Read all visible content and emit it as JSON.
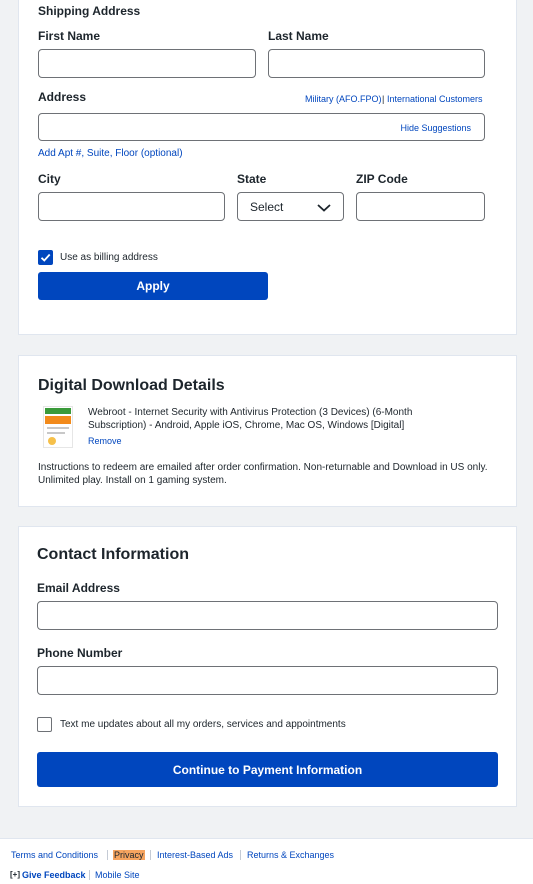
{
  "shipping": {
    "section_title": "Shipping Address",
    "first_name_label": "First Name",
    "first_name_value": "",
    "last_name_label": "Last Name",
    "last_name_value": "",
    "address_label": "Address",
    "military_link": "Military (AFO.FPO)",
    "divider": "|",
    "international_link": "International Customers",
    "address_value": "",
    "hide_suggestions": "Hide Suggestions",
    "add_apt": "Add Apt #, Suite, Floor (optional)",
    "city_label": "City",
    "city_value": "",
    "state_label": "State",
    "state_value": "Select",
    "zip_label": "ZIP Code",
    "zip_value": "",
    "billing_checkbox_label": "Use as billing address",
    "billing_checked": true,
    "apply_button": "Apply"
  },
  "digital": {
    "title": "Digital Download Details",
    "product_name": "Webroot - Internet Security with Antivirus Protection (3 Devices) (6-Month Subscription) - Android, Apple iOS, Chrome, Mac OS, Windows [Digital]",
    "remove": "Remove",
    "instructions": "Instructions to redeem are emailed after order confirmation. Non-returnable and Download in US only. Unlimited play. Install on 1 gaming system."
  },
  "contact": {
    "title": "Contact Information",
    "email_label": "Email Address",
    "email_value": "",
    "phone_label": "Phone Number",
    "phone_value": "",
    "text_updates_label": "Text me updates about all my orders, services and appointments",
    "text_updates_checked": false,
    "continue_button": "Continue to Payment Information"
  },
  "footer": {
    "terms": "Terms and Conditions",
    "privacy": "Privacy",
    "interest_ads": "Interest-Based Ads",
    "returns": "Returns & Exchanges",
    "feedback_icon": "[+]",
    "give_feedback": "Give Feedback",
    "mobile_site": "Mobile Site"
  },
  "colors": {
    "brand_blue": "#0046be",
    "privacy_highlight": "#f6a45f"
  },
  "icons": {
    "chevron": "chevron-down-icon",
    "check": "checkmark-icon",
    "feedback": "feedback-icon"
  }
}
